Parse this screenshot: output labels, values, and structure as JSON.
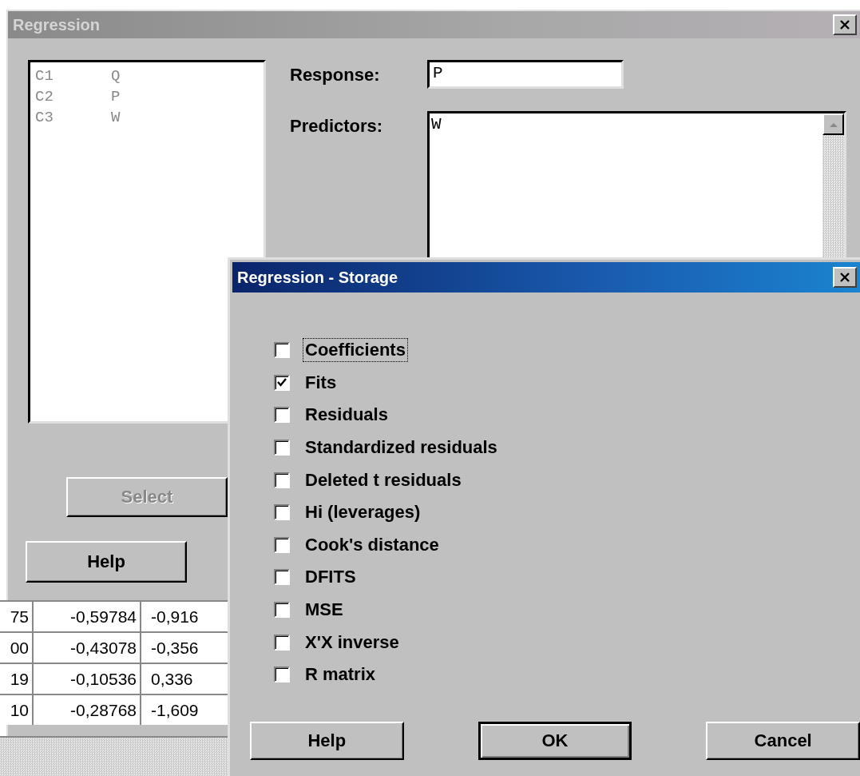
{
  "main_dialog": {
    "title": "Regression",
    "active": false,
    "variables": [
      {
        "column": "C1",
        "name": "Q"
      },
      {
        "column": "C2",
        "name": "P"
      },
      {
        "column": "C3",
        "name": "W"
      }
    ],
    "response": {
      "label": "Response:",
      "value": "P"
    },
    "predictors": {
      "label": "Predictors:",
      "value": "W"
    },
    "buttons": [
      {
        "label": "Select",
        "disabled": true
      },
      {
        "label": "Help",
        "disabled": false
      }
    ]
  },
  "worksheet": {
    "rows": [
      [
        "75",
        "-0,59784",
        "-0,916"
      ],
      [
        "00",
        "-0,43078",
        "-0,356"
      ],
      [
        "19",
        "-0,10536",
        "0,336"
      ],
      [
        "10",
        "-0,28768",
        "-1,609"
      ]
    ]
  },
  "storage_dialog": {
    "title": "Regression - Storage",
    "active": true,
    "options": [
      {
        "label": "Coefficients",
        "checked": false,
        "focused": true
      },
      {
        "label": "Fits",
        "checked": true,
        "focused": false
      },
      {
        "label": "Residuals",
        "checked": false,
        "focused": false
      },
      {
        "label": "Standardized residuals",
        "checked": false,
        "focused": false
      },
      {
        "label": "Deleted t residuals",
        "checked": false,
        "focused": false
      },
      {
        "label": "Hi (leverages)",
        "checked": false,
        "focused": false
      },
      {
        "label": "Cook's distance",
        "checked": false,
        "focused": false
      },
      {
        "label": "DFITS",
        "checked": false,
        "focused": false
      },
      {
        "label": "MSE",
        "checked": false,
        "focused": false
      },
      {
        "label": "X'X inverse",
        "checked": false,
        "focused": false
      },
      {
        "label": "R matrix",
        "checked": false,
        "focused": false
      }
    ],
    "buttons": [
      {
        "label": "Help",
        "default": false
      },
      {
        "label": "OK",
        "default": true
      },
      {
        "label": "Cancel",
        "default": false
      }
    ]
  }
}
